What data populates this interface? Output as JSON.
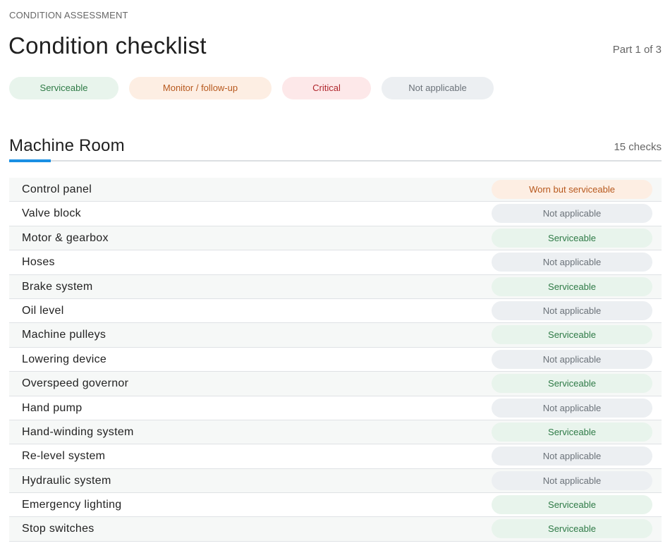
{
  "header": {
    "eyebrow": "CONDITION ASSESSMENT",
    "title": "Condition checklist",
    "part": "Part 1 of 3"
  },
  "legend": [
    {
      "label": "Serviceable",
      "kind": "green"
    },
    {
      "label": "Monitor / follow-up",
      "kind": "orange"
    },
    {
      "label": "Critical",
      "kind": "red"
    },
    {
      "label": "Not applicable",
      "kind": "gray"
    }
  ],
  "colors": {
    "accent": "#1a8fe3",
    "serviceable_bg": "#e8f4ec",
    "serviceable_text": "#2e7a46",
    "monitor_bg": "#fdeee3",
    "monitor_text": "#b7581d",
    "critical_bg": "#fde8e9",
    "critical_text": "#b0262c",
    "na_bg": "#eceff2",
    "na_text": "#6b7279"
  },
  "section": {
    "title": "Machine Room",
    "count": "15 checks",
    "items": [
      {
        "label": "Control panel",
        "status": "Worn but serviceable",
        "kind": "orange"
      },
      {
        "label": "Valve block",
        "status": "Not applicable",
        "kind": "gray"
      },
      {
        "label": "Motor & gearbox",
        "status": "Serviceable",
        "kind": "green"
      },
      {
        "label": "Hoses",
        "status": "Not applicable",
        "kind": "gray"
      },
      {
        "label": "Brake system",
        "status": "Serviceable",
        "kind": "green"
      },
      {
        "label": "Oil level",
        "status": "Not applicable",
        "kind": "gray"
      },
      {
        "label": "Machine pulleys",
        "status": "Serviceable",
        "kind": "green"
      },
      {
        "label": "Lowering device",
        "status": "Not applicable",
        "kind": "gray"
      },
      {
        "label": "Overspeed governor",
        "status": "Serviceable",
        "kind": "green"
      },
      {
        "label": "Hand pump",
        "status": "Not applicable",
        "kind": "gray"
      },
      {
        "label": "Hand-winding system",
        "status": "Serviceable",
        "kind": "green"
      },
      {
        "label": "Re-level system",
        "status": "Not applicable",
        "kind": "gray"
      },
      {
        "label": "Hydraulic system",
        "status": "Not applicable",
        "kind": "gray"
      },
      {
        "label": "Emergency lighting",
        "status": "Serviceable",
        "kind": "green"
      },
      {
        "label": "Stop switches",
        "status": "Serviceable",
        "kind": "green"
      }
    ]
  }
}
